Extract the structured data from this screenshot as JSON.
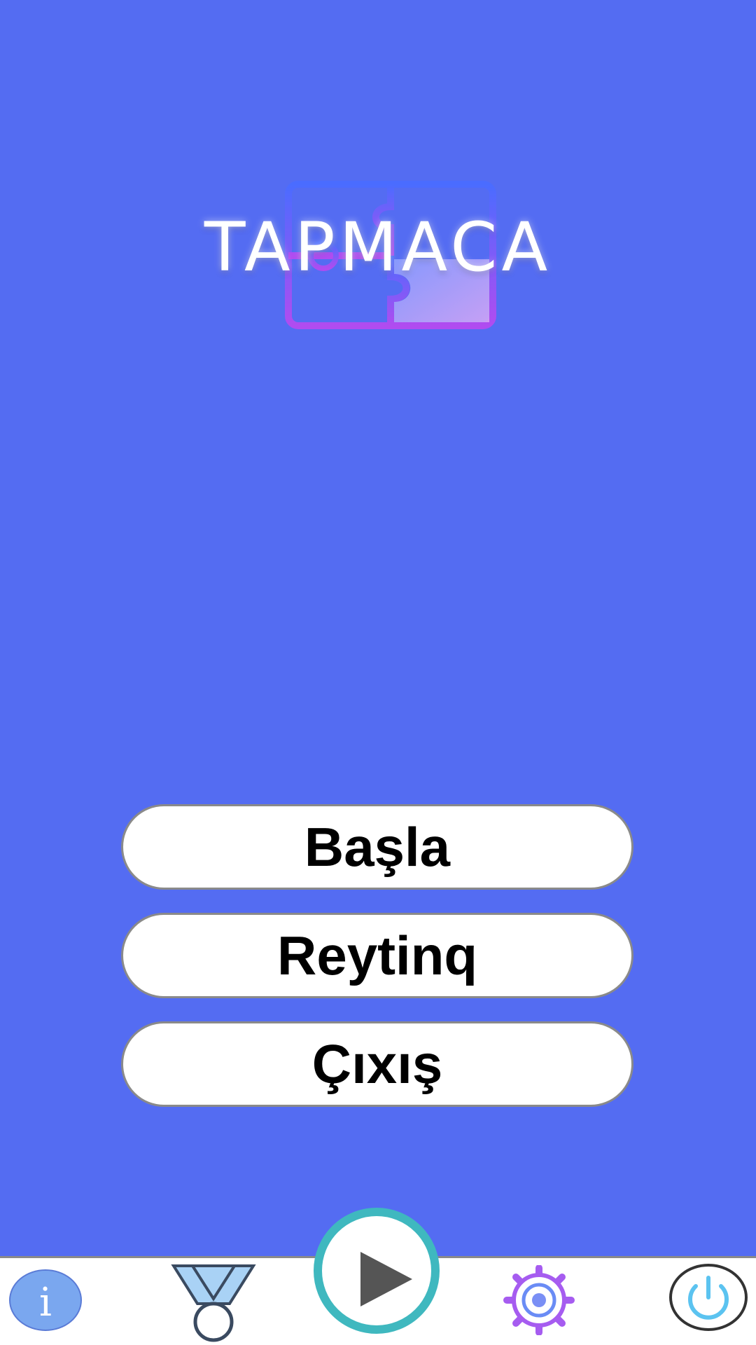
{
  "app": {
    "title": "TAPMACA"
  },
  "menu": {
    "start_label": "Başla",
    "rating_label": "Reytinq",
    "exit_label": "Çıxış"
  },
  "bottom_bar": {
    "info_icon": "info-icon",
    "info_glyph": "i",
    "medal_icon": "medal-icon",
    "play_icon": "play-icon",
    "gear_icon": "gear-icon",
    "power_icon": "power-icon"
  },
  "colors": {
    "background": "#546cf2",
    "button_bg": "#ffffff",
    "button_border": "#8a8a8a",
    "play_ring": "#3fb8bf",
    "info_circle": "#7aa7ef",
    "power_icon": "#5bc3f0",
    "gear_icon": "#a65cf0"
  }
}
